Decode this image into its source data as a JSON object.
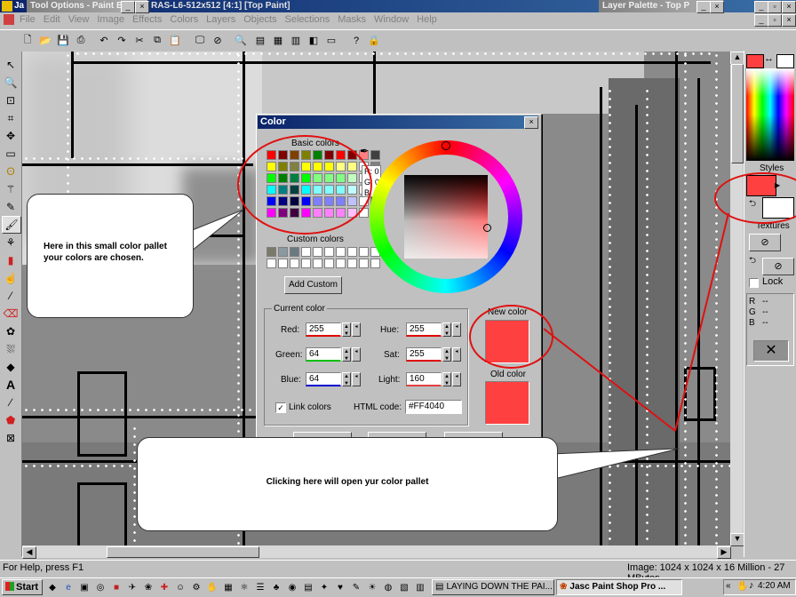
{
  "app": {
    "title_fragment": "Ja",
    "tool_options_title": "Tool Options - Paint B",
    "doc_title": "RAS-L6-512x512 [4:1] [Top Paint]",
    "layer_palette_title": "Layer Palette - Top P"
  },
  "menu": [
    "File",
    "Edit",
    "View",
    "Image",
    "Effects",
    "Colors",
    "Layers",
    "Objects",
    "Selections",
    "Masks",
    "Window",
    "Help"
  ],
  "color_dialog": {
    "title": "Color",
    "basic_colors_label": "Basic colors",
    "custom_colors_label": "Custom colors",
    "add_custom_label": "Add Custom",
    "rgb_readout": {
      "r": "R: 0",
      "g": "G: 0",
      "b": "B: 0"
    },
    "current_color_label": "Current color",
    "new_color_label": "New color",
    "old_color_label": "Old color",
    "fields": {
      "red_label": "Red:",
      "red": "255",
      "green_label": "Green:",
      "green": "64",
      "blue_label": "Blue:",
      "blue": "64",
      "hue_label": "Hue:",
      "hue": "255",
      "sat_label": "Sat:",
      "sat": "255",
      "light_label": "Light:",
      "light": "160"
    },
    "link_colors_label": "Link colors",
    "html_code_label": "HTML code:",
    "html_code": "#FF4040",
    "new_color": "#ff4040",
    "old_color": "#ff4040",
    "basic_colors": [
      [
        "#ff0000",
        "#800000",
        "#804000",
        "#808000",
        "#008000",
        "#800000",
        "#ff0000",
        "#800000",
        "#ff8080",
        "#404040"
      ],
      [
        "#ffff00",
        "#808000",
        "#808040",
        "#ffff00",
        "#ffff00",
        "#ffff00",
        "#ffff80",
        "#ffff80",
        "#ffffff",
        "#808080"
      ],
      [
        "#00ff00",
        "#008000",
        "#008040",
        "#00ff00",
        "#80ff80",
        "#80ff80",
        "#80ff80",
        "#c0ffc0",
        "#ffffff",
        "#c0c0c0"
      ],
      [
        "#00ffff",
        "#008080",
        "#004040",
        "#00ffff",
        "#80ffff",
        "#80ffff",
        "#80ffff",
        "#c0ffff",
        "#ffffff",
        "#808080"
      ],
      [
        "#0000ff",
        "#000080",
        "#000040",
        "#0000ff",
        "#8080ff",
        "#8080ff",
        "#8080ff",
        "#c0c0ff",
        "#ffffff",
        "#404040"
      ],
      [
        "#ff00ff",
        "#800080",
        "#400040",
        "#ff00ff",
        "#ff80ff",
        "#ff80ff",
        "#ff80ff",
        "#ffc0ff",
        "#ffffff",
        "#000000"
      ]
    ],
    "custom_colors": [
      "#7a7a6a",
      "#8a9aa0",
      "#6a7a80",
      "#ffffff",
      "#ffffff",
      "#ffffff",
      "#ffffff",
      "#ffffff",
      "#ffffff",
      "#ffffff"
    ]
  },
  "callouts": {
    "left": "Here in this small color pallet your colors are chosen.",
    "bottom": "Clicking here will open yur color pallet"
  },
  "right_panel": {
    "styles_label": "Styles",
    "textures_label": "Textures",
    "lock_label": "Lock",
    "r_label": "R",
    "g_label": "G",
    "b_label": "B",
    "r_value": "--",
    "g_value": "--",
    "b_value": "--",
    "foreground_color": "#ff4040"
  },
  "status": {
    "help_text": "For Help, press F1",
    "image_info": "Image:  1024 x 1024 x 16 Million - 27 MBytes"
  },
  "taskbar": {
    "start_label": "Start",
    "task1": "LAYING DOWN THE PAI...",
    "task2": "Jasc Paint Shop Pro ...",
    "clock": "4:20 AM"
  }
}
